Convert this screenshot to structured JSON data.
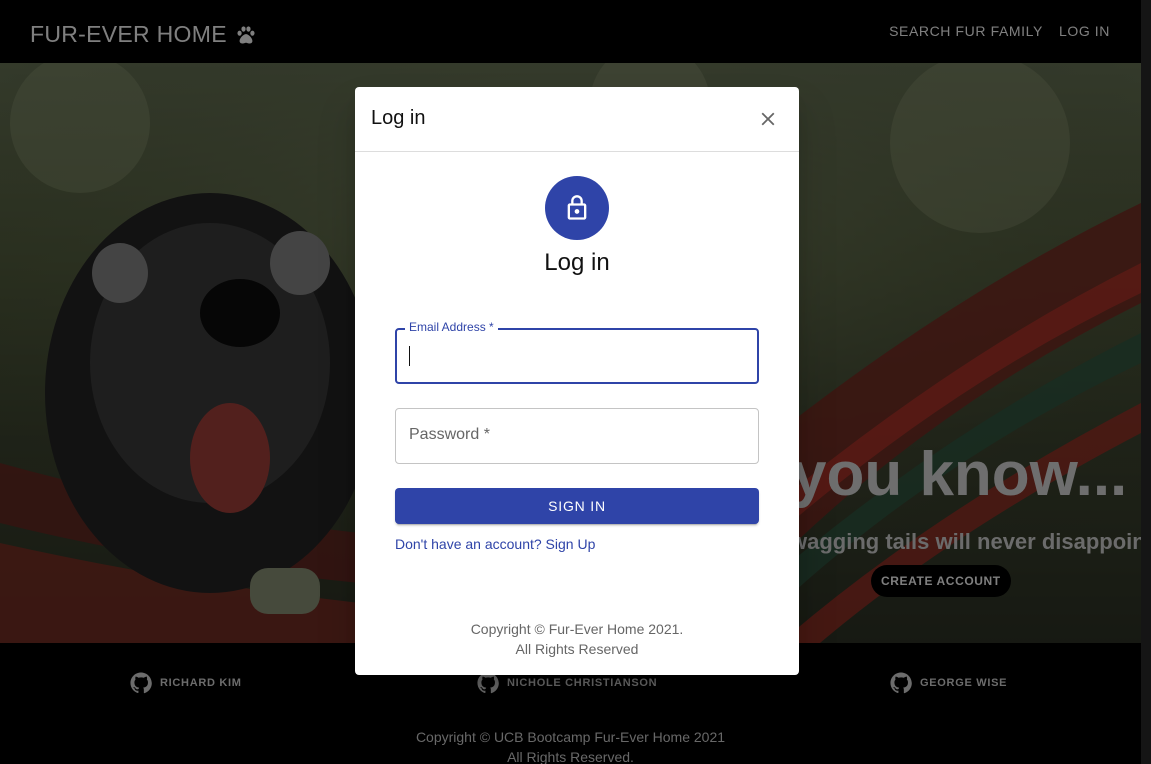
{
  "navbar": {
    "brand": "FUR-EVER HOME",
    "links": [
      "SEARCH FUR FAMILY",
      "LOG IN"
    ]
  },
  "hero": {
    "heading": "you know...",
    "subheading": "wagging tails will never disappoint",
    "cta": "CREATE ACCOUNT"
  },
  "footer": {
    "credits": [
      "RICHARD KIM",
      "NICHOLE CHRISTIANSON",
      "GEORGE WISE"
    ],
    "copyright_line1": "Copyright © UCB Bootcamp Fur-Ever Home 2021",
    "copyright_line2": "All Rights Reserved."
  },
  "modal": {
    "title": "Log in",
    "heading": "Log in",
    "email_label": "Email Address *",
    "email_value": "",
    "password_label": "Password *",
    "password_value": "",
    "submit": "SIGN IN",
    "signup_link": "Don't have an account? Sign Up",
    "copyright_line1": "Copyright © Fur-Ever Home 2021.",
    "copyright_line2": "All Rights Reserved"
  },
  "colors": {
    "primary": "#2f44a8",
    "navbar": "#000000",
    "backdrop": "rgba(0,0,0,0.5)"
  },
  "icons": [
    "paw-icon",
    "close-icon",
    "lock-icon",
    "github-icon"
  ]
}
